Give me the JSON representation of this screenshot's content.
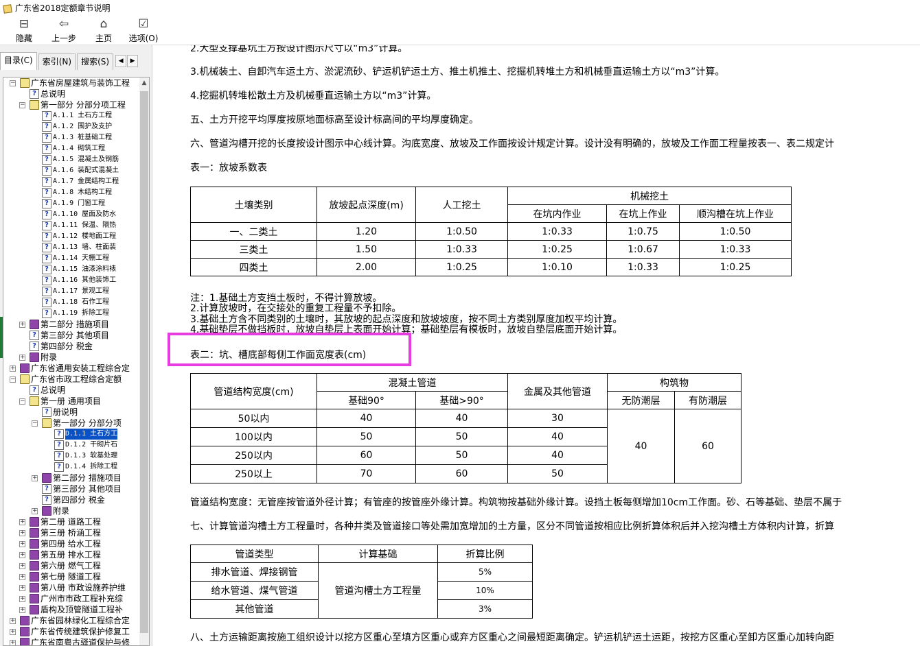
{
  "window": {
    "title": "广东省2018定额章节说明"
  },
  "toolbar": {
    "hide": "隐藏",
    "back": "上一步",
    "home": "主页",
    "options": "选项(O)"
  },
  "tabs": {
    "contents": "目录(C)",
    "index": "索引(N)",
    "search": "搜索(S)",
    "prev": "◀",
    "next": "▶"
  },
  "tree": [
    {
      "label": "广东省房屋建筑与装饰工程",
      "exp": "−",
      "icon": "book open"
    },
    {
      "label": "总说明",
      "icon": "doc"
    },
    {
      "label": "第一部分 分部分项工程",
      "exp": "−",
      "icon": "book open"
    },
    {
      "label": "A.1.1 土石方工程",
      "icon": "doc",
      "code": true
    },
    {
      "label": "A.1.2 围护及支护",
      "icon": "doc",
      "code": true
    },
    {
      "label": "A.1.3 桩基础工程",
      "icon": "doc",
      "code": true
    },
    {
      "label": "A.1.4 砌筑工程",
      "icon": "doc",
      "code": true
    },
    {
      "label": "A.1.5 混凝土及钢筋",
      "icon": "doc",
      "code": true
    },
    {
      "label": "A.1.6 装配式混凝土",
      "icon": "doc",
      "code": true
    },
    {
      "label": "A.1.7 金属结构工程",
      "icon": "doc",
      "code": true
    },
    {
      "label": "A.1.8 木结构工程",
      "icon": "doc",
      "code": true
    },
    {
      "label": "A.1.9 门窗工程",
      "icon": "doc",
      "code": true
    },
    {
      "label": "A.1.10 屋面及防水",
      "icon": "doc",
      "code": true
    },
    {
      "label": "A.1.11 保温、隔热",
      "icon": "doc",
      "code": true
    },
    {
      "label": "A.1.12 楼地面工程",
      "icon": "doc",
      "code": true
    },
    {
      "label": "A.1.13 墙、柱面装",
      "icon": "doc",
      "code": true
    },
    {
      "label": "A.1.14 天棚工程",
      "icon": "doc",
      "code": true
    },
    {
      "label": "A.1.15 油漆涂料裱",
      "icon": "doc",
      "code": true
    },
    {
      "label": "A.1.16 其他装饰工",
      "icon": "doc",
      "code": true
    },
    {
      "label": "A.1.17 景观工程",
      "icon": "doc",
      "code": true
    },
    {
      "label": "A.1.18 石作工程",
      "icon": "doc",
      "code": true
    },
    {
      "label": "A.1.19 拆除工程",
      "icon": "doc",
      "code": true
    },
    {
      "label": "第二部分 措施项目",
      "exp": "+",
      "icon": "book"
    },
    {
      "label": "第三部分 其他项目",
      "icon": "doc"
    },
    {
      "label": "第四部分 税金",
      "icon": "doc"
    },
    {
      "label": "附录",
      "exp": "+",
      "icon": "book"
    },
    {
      "label": "广东省通用安装工程综合定",
      "exp": "+",
      "icon": "book"
    },
    {
      "label": "广东省市政工程综合定额",
      "exp": "−",
      "icon": "book open"
    },
    {
      "label": "总说明",
      "icon": "doc"
    },
    {
      "label": "第一册 通用项目",
      "exp": "−",
      "icon": "book open"
    },
    {
      "label": "册说明",
      "icon": "doc"
    },
    {
      "label": "第一部分 分部分项",
      "exp": "−",
      "icon": "book open"
    },
    {
      "label": "D.1.1 土石方工",
      "icon": "doc",
      "code": true,
      "selected": true
    },
    {
      "label": "D.1.2 干砌片石",
      "icon": "doc",
      "code": true
    },
    {
      "label": "D.1.3 软基处理",
      "icon": "doc",
      "code": true
    },
    {
      "label": "D.1.4 拆除工程",
      "icon": "doc",
      "code": true
    },
    {
      "label": "第二部分 措施项目",
      "exp": "+",
      "icon": "book"
    },
    {
      "label": "第三部分 其他项目",
      "icon": "doc"
    },
    {
      "label": "第四部分 税金",
      "icon": "doc"
    },
    {
      "label": "附录",
      "exp": "+",
      "icon": "book"
    },
    {
      "label": "第二册 道路工程",
      "exp": "+",
      "icon": "book"
    },
    {
      "label": "第三册 桥涵工程",
      "exp": "+",
      "icon": "book"
    },
    {
      "label": "第四册 给水工程",
      "exp": "+",
      "icon": "book"
    },
    {
      "label": "第五册 排水工程",
      "exp": "+",
      "icon": "book"
    },
    {
      "label": "第六册 燃气工程",
      "exp": "+",
      "icon": "book"
    },
    {
      "label": "第七册 隧道工程",
      "exp": "+",
      "icon": "book"
    },
    {
      "label": "第八册 市政设施养护维",
      "exp": "+",
      "icon": "book"
    },
    {
      "label": "广州市市政工程补充综",
      "exp": "+",
      "icon": "book"
    },
    {
      "label": "盾构及顶管隧道工程补",
      "exp": "+",
      "icon": "book"
    },
    {
      "label": "广东省园林绿化工程综合定",
      "exp": "+",
      "icon": "book"
    },
    {
      "label": "广东省传统建筑保护修复工",
      "exp": "+",
      "icon": "book"
    },
    {
      "label": "广东省南粤古驿道保护与修",
      "exp": "+",
      "icon": "book"
    }
  ],
  "doc": {
    "p_cut": "2.大型支撑基坑土方按设计图示尺寸以“m3”计算。",
    "p3": "3.机械装土、自卸汽车运土方、淤泥流砂、铲运机铲运土方、推土机推土、挖掘机转堆土方和机械垂直运输土方以“m3”计算。",
    "p4": "4.挖掘机转堆松散土方及机械垂直运输土方以“m3”计算。",
    "p5": "五、土方开挖平均厚度按原地面标高至设计标高间的平均厚度确定。",
    "p6": "六、管道沟槽开挖的长度按设计图示中心线计算。沟底宽度、放坡及工作面按设计规定计算。设计没有明确的，放坡及工作面工程量按表一、表二规定计",
    "t1_caption": "表一：放坡系数表",
    "t1": {
      "h_soil": "土壤类别",
      "h_depth": "放坡起点深度(m)",
      "h_manual": "人工挖土",
      "h_machine": "机械挖土",
      "h_in": "在坑内作业",
      "h_on": "在坑上作业",
      "h_along": "顺沟槽在坑上作业",
      "rows": [
        [
          "一、二类土",
          "1.20",
          "1:0.50",
          "1:0.33",
          "1:0.75",
          "1:0.50"
        ],
        [
          "三类土",
          "1.50",
          "1:0.33",
          "1:0.25",
          "1:0.67",
          "1:0.33"
        ],
        [
          "四类土",
          "2.00",
          "1:0.25",
          "1:0.10",
          "1:0.33",
          "1:0.25"
        ]
      ]
    },
    "note1": "注：1.基础土方支挡土板时，不得计算放坡。",
    "note2": "2.计算放坡时，在交接处的重复工程量不予扣除。",
    "note3": "3.基础土方含不同类别的土壤时，其放坡的起点深度和放坡坡度，按不同土方类别厚度加权平均计算。",
    "note4": "4.基础垫层不做挡板时，放坡自垫层上表面开始计算；基础垫层有模板时，放坡自垫层底面开始计算。",
    "t2_caption": "表二：坑、槽底部每侧工作面宽度表(cm)",
    "t2": {
      "h_width": "管道结构宽度(cm)",
      "h_concrete": "混凝土管道",
      "h_b90": "基础90°",
      "h_bgt90": "基础>90°",
      "h_metal": "金属及其他管道",
      "h_struct": "构筑物",
      "h_nomoist": "无防潮层",
      "h_moist": "有防潮层",
      "rows": [
        [
          "50以内",
          "40",
          "40",
          "30"
        ],
        [
          "100以内",
          "50",
          "50",
          "40"
        ],
        [
          "250以内",
          "60",
          "50",
          "40"
        ],
        [
          "250以上",
          "70",
          "60",
          "50"
        ]
      ],
      "nomoist_val": "40",
      "moist_val": "60"
    },
    "p_pipe": "管道结构宽度：无管座按管道外径计算；有管座的按管座外缘计算。构筑物按基础外缘计算。设挡土板每侧增加10cm工作面。砂、石等基础、垫层不属于",
    "p7": "七、计算管道沟槽土方工程量时，各种井类及管道接口等处需加宽增加的土方量，区分不同管道按相应比例折算体积后并入挖沟槽土方体积内计算，折算",
    "t3": {
      "h_type": "管道类型",
      "h_base": "计算基础",
      "h_ratio": "折算比例",
      "base_val": "管道沟槽土方工程量",
      "rows": [
        [
          "排水管道、焊接钢管",
          "5%"
        ],
        [
          "给水管道、煤气管道",
          "10%"
        ],
        [
          "其他管道",
          "3%"
        ]
      ]
    },
    "p8": "八、土方运输距离按施工组织设计以挖方区重心至填方区重心或弃方区重心之间最短距离确定。铲运机铲运土运距，按挖方区重心至卸方区重心加转向距"
  },
  "colors": {
    "highlight": "#e63ce0",
    "selection": "#0a52c4"
  }
}
